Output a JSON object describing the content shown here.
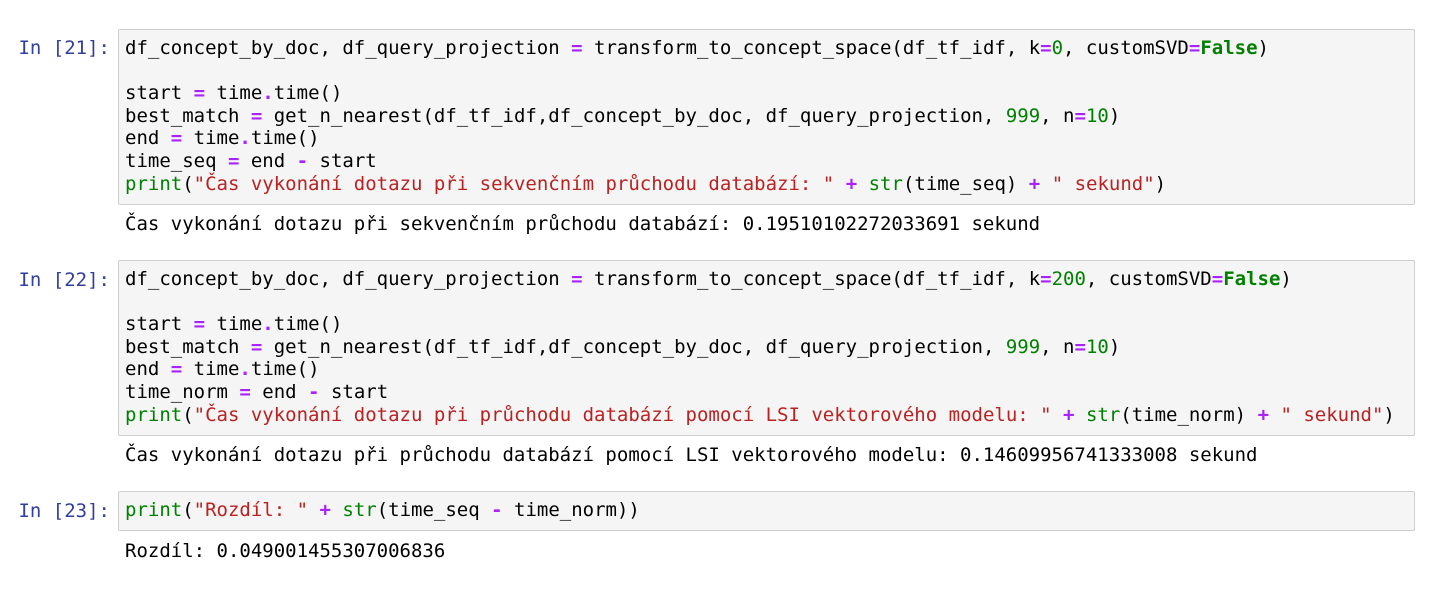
{
  "cells": [
    {
      "prompt": "In [21]:",
      "code": [
        [
          [
            "df_concept_by_doc, df_query_projection ",
            ""
          ],
          [
            "=",
            "op"
          ],
          [
            " transform_to_concept_space(df_tf_idf, k",
            ""
          ],
          [
            "=",
            "op"
          ],
          [
            "0",
            "num"
          ],
          [
            ", customSVD",
            ""
          ],
          [
            "=",
            "op"
          ],
          [
            "False",
            "kw"
          ],
          [
            ")",
            ""
          ]
        ],
        [],
        [
          [
            "start ",
            ""
          ],
          [
            "=",
            "op"
          ],
          [
            " time",
            ""
          ],
          [
            ".",
            "op"
          ],
          [
            "time()",
            ""
          ]
        ],
        [
          [
            "best_match ",
            ""
          ],
          [
            "=",
            "op"
          ],
          [
            " get_n_nearest(df_tf_idf,df_concept_by_doc, df_query_projection, ",
            ""
          ],
          [
            "999",
            "num"
          ],
          [
            ", n",
            ""
          ],
          [
            "=",
            "op"
          ],
          [
            "10",
            "num"
          ],
          [
            ")",
            ""
          ]
        ],
        [
          [
            "end ",
            ""
          ],
          [
            "=",
            "op"
          ],
          [
            " time",
            ""
          ],
          [
            ".",
            "op"
          ],
          [
            "time()",
            ""
          ]
        ],
        [
          [
            "time_seq ",
            ""
          ],
          [
            "=",
            "op"
          ],
          [
            " end ",
            ""
          ],
          [
            "-",
            "op"
          ],
          [
            " start",
            ""
          ]
        ],
        [
          [
            "print",
            "builtin"
          ],
          [
            "(",
            ""
          ],
          [
            "\"Čas vykonání dotazu při sekvenčním průchodu databází: \"",
            "str"
          ],
          [
            " ",
            ""
          ],
          [
            "+",
            "op"
          ],
          [
            " ",
            ""
          ],
          [
            "str",
            "builtin"
          ],
          [
            "(time_seq) ",
            ""
          ],
          [
            "+",
            "op"
          ],
          [
            " ",
            ""
          ],
          [
            "\" sekund\"",
            "str"
          ],
          [
            ")",
            ""
          ]
        ]
      ],
      "output": "Čas vykonání dotazu při sekvenčním průchodu databází: 0.19510102272033691 sekund"
    },
    {
      "prompt": "In [22]:",
      "code": [
        [
          [
            "df_concept_by_doc, df_query_projection ",
            ""
          ],
          [
            "=",
            "op"
          ],
          [
            " transform_to_concept_space(df_tf_idf, k",
            ""
          ],
          [
            "=",
            "op"
          ],
          [
            "200",
            "num"
          ],
          [
            ", customSVD",
            ""
          ],
          [
            "=",
            "op"
          ],
          [
            "False",
            "kw"
          ],
          [
            ")",
            ""
          ]
        ],
        [],
        [
          [
            "start ",
            ""
          ],
          [
            "=",
            "op"
          ],
          [
            " time",
            ""
          ],
          [
            ".",
            "op"
          ],
          [
            "time()",
            ""
          ]
        ],
        [
          [
            "best_match ",
            ""
          ],
          [
            "=",
            "op"
          ],
          [
            " get_n_nearest(df_tf_idf,df_concept_by_doc, df_query_projection, ",
            ""
          ],
          [
            "999",
            "num"
          ],
          [
            ", n",
            ""
          ],
          [
            "=",
            "op"
          ],
          [
            "10",
            "num"
          ],
          [
            ")",
            ""
          ]
        ],
        [
          [
            "end ",
            ""
          ],
          [
            "=",
            "op"
          ],
          [
            " time",
            ""
          ],
          [
            ".",
            "op"
          ],
          [
            "time()",
            ""
          ]
        ],
        [
          [
            "time_norm ",
            ""
          ],
          [
            "=",
            "op"
          ],
          [
            " end ",
            ""
          ],
          [
            "-",
            "op"
          ],
          [
            " start",
            ""
          ]
        ],
        [
          [
            "print",
            "builtin"
          ],
          [
            "(",
            ""
          ],
          [
            "\"Čas vykonání dotazu při průchodu databází pomocí LSI vektorového modelu: \"",
            "str"
          ],
          [
            " ",
            ""
          ],
          [
            "+",
            "op"
          ],
          [
            " ",
            ""
          ],
          [
            "str",
            "builtin"
          ],
          [
            "(time_norm) ",
            ""
          ],
          [
            "+",
            "op"
          ],
          [
            " ",
            ""
          ],
          [
            "\" sekund\"",
            "str"
          ],
          [
            ")",
            ""
          ]
        ]
      ],
      "output": "Čas vykonání dotazu při průchodu databází pomocí LSI vektorového modelu: 0.14609956741333008 sekund"
    },
    {
      "prompt": "In [23]:",
      "code": [
        [
          [
            "print",
            "builtin"
          ],
          [
            "(",
            ""
          ],
          [
            "\"Rozdíl: \"",
            "str"
          ],
          [
            " ",
            ""
          ],
          [
            "+",
            "op"
          ],
          [
            " ",
            ""
          ],
          [
            "str",
            "builtin"
          ],
          [
            "(time_seq ",
            ""
          ],
          [
            "-",
            "op"
          ],
          [
            " time_norm))",
            ""
          ]
        ]
      ],
      "output": "Rozdíl: 0.049001455307006836"
    }
  ],
  "colors": {
    "prompt": "#303f9f",
    "cell_bg": "#f5f5f5",
    "cell_border": "#cfcfcf",
    "operator": "#aa22ff",
    "number": "#008000",
    "keyword": "#008000",
    "string": "#ba2121"
  }
}
